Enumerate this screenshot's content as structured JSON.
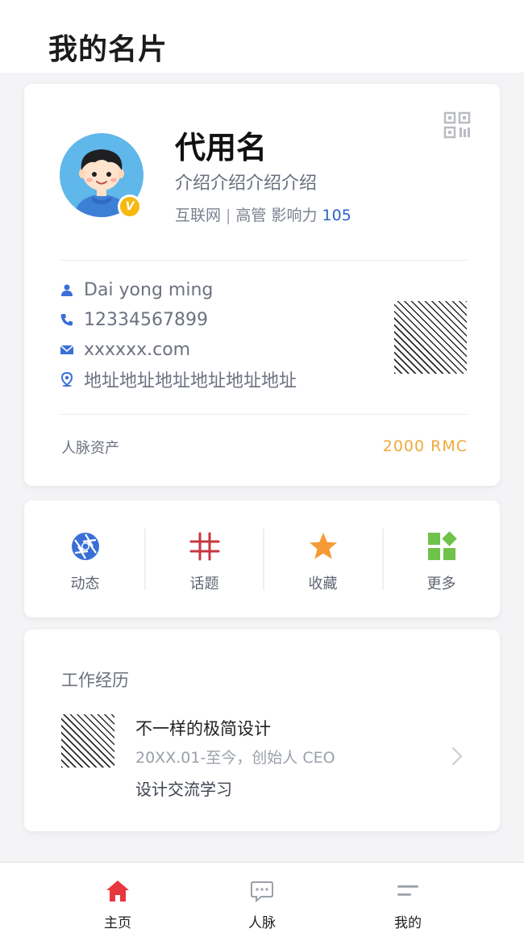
{
  "page": {
    "title": "我的名片"
  },
  "profile": {
    "name": "代用名",
    "intro": "介绍介绍介绍介绍",
    "industry": "互联网",
    "separator": "|",
    "role": "高管",
    "influence_label": "影响力",
    "influence_value": "105",
    "verified_badge": "V"
  },
  "contact": {
    "name_en": "Dai yong ming",
    "phone": "12334567899",
    "email": "xxxxxx.com",
    "address": "地址地址地址地址地址地址"
  },
  "assets": {
    "label": "人脉资产",
    "value": "2000  RMC"
  },
  "actions": [
    {
      "label": "动态",
      "icon": "aperture-icon"
    },
    {
      "label": "话题",
      "icon": "hashtag-icon"
    },
    {
      "label": "收藏",
      "icon": "star-icon"
    },
    {
      "label": "更多",
      "icon": "grid-more-icon"
    }
  ],
  "work": {
    "title": "工作经历",
    "item": {
      "name": "不一样的极简设计",
      "period": "20XX.01-至今，创始人 CEO",
      "desc": "设计交流学习"
    }
  },
  "tabbar": [
    {
      "label": "主页",
      "icon": "home-icon",
      "active": true
    },
    {
      "label": "人脉",
      "icon": "chat-bubble-icon",
      "active": false
    },
    {
      "label": "我的",
      "icon": "menu-icon",
      "active": false
    }
  ],
  "colors": {
    "accent_blue": "#2b63c8",
    "asset_orange": "#f0a93a",
    "badge_yellow": "#f5b90f",
    "home_red": "#e8373f"
  }
}
